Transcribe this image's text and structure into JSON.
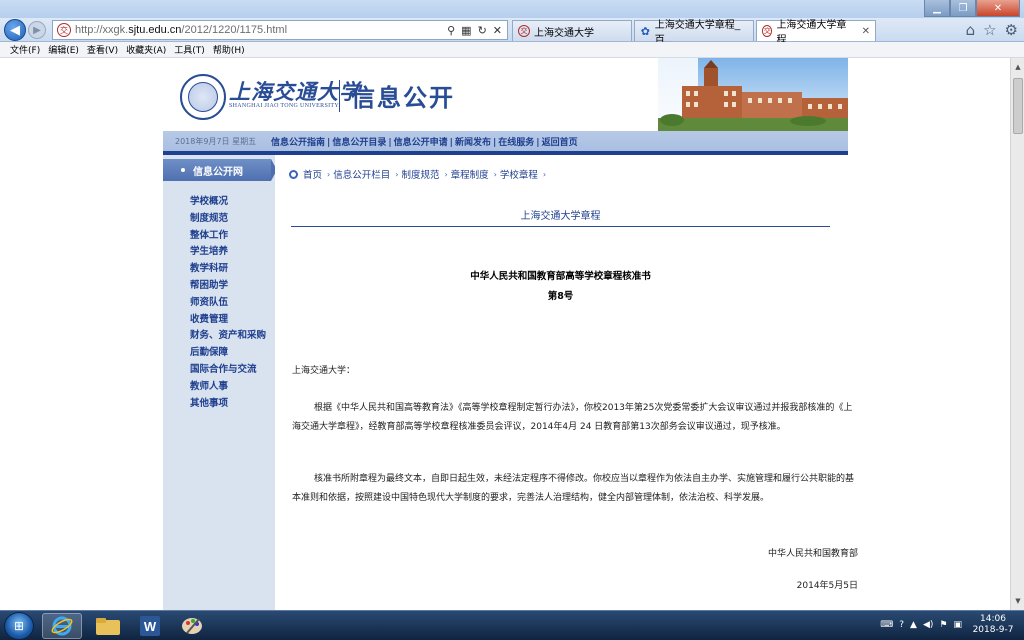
{
  "browser": {
    "url_prefix": "http://xxgk.",
    "url_host": "sjtu.edu.cn",
    "url_path": "/2012/1220/1175.html",
    "tabs": [
      {
        "label": "上海交通大学",
        "active": false
      },
      {
        "label": "上海交通大学章程_百...",
        "active": false
      },
      {
        "label": "上海交通大学章程_...",
        "active": true
      }
    ],
    "menu": [
      "文件(F)",
      "编辑(E)",
      "查看(V)",
      "收藏夹(A)",
      "工具(T)",
      "帮助(H)"
    ]
  },
  "site": {
    "logo_cn": "上海交通大学",
    "logo_en": "SHANGHAI JIAO TONG UNIVERSITY",
    "title": "信息公开",
    "date": "2018年9月7日 星期五",
    "nav_links": [
      "信息公开指南",
      "信息公开目录",
      "信息公开申请",
      "新闻发布",
      "在线服务",
      "返回首页"
    ]
  },
  "sidebar": {
    "head": "信息公开网",
    "items": [
      "学校概况",
      "制度规范",
      "整体工作",
      "学生培养",
      "教学科研",
      "帮困助学",
      "师资队伍",
      "收费管理",
      "财务、资产和采购",
      "后勤保障",
      "国际合作与交流",
      "教师人事",
      "其他事项"
    ]
  },
  "breadcrumb": [
    "首页",
    "信息公开栏目",
    "制度规范",
    "章程制度",
    "学校章程"
  ],
  "article": {
    "title": "上海交通大学章程",
    "doc_title": "中华人民共和国教育部高等学校章程核准书",
    "doc_number": "第8号",
    "salutation": "上海交通大学：",
    "para1": "根据《中华人民共和国高等教育法》《高等学校章程制定暂行办法》，你校2013年第25次党委常委扩大会议审议通过并报我部核准的《上海交通大学章程》，经教育部高等学校章程核准委员会评议，2014年4月 24 日教育部第13次部务会议审议通过，现予核准。",
    "para2": "核准书所附章程为最终文本，自即日起生效，未经法定程序不得修改。你校应当以章程作为依法自主办学、实施管理和履行公共职能的基本准则和依据，按照建设中国特色现代大学制度的要求，完善法人治理结构，健全内部管理体制，依法治校、科学发展。",
    "sign_org": "中华人民共和国教育部",
    "sign_date": "2014年5月5日"
  },
  "taskbar": {
    "time": "14:06",
    "date": "2018-9-7"
  }
}
